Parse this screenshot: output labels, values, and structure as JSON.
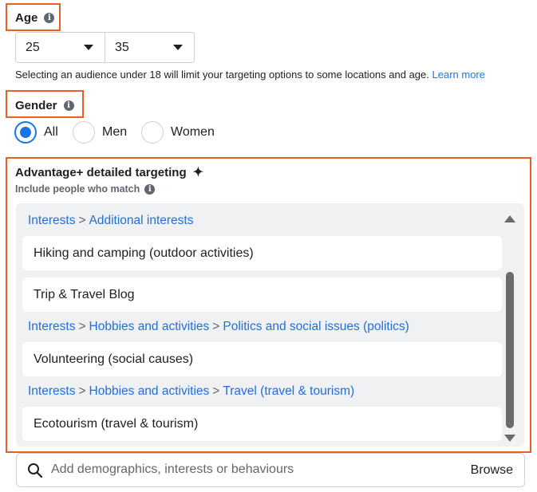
{
  "age": {
    "label": "Age",
    "info_icon": "i",
    "min_value": "25",
    "max_value": "35",
    "note": "Selecting an audience under 18 will limit your targeting options to some locations and age.",
    "learn_more": "Learn more"
  },
  "gender": {
    "label": "Gender",
    "info_icon": "i",
    "options": [
      "All",
      "Men",
      "Women"
    ],
    "selected": "All"
  },
  "detailed_targeting": {
    "title": "Advantage+ detailed targeting",
    "title_icon": "✦",
    "subtitle": "Include people who match",
    "info_icon": "i",
    "groups": [
      {
        "crumbs": [
          "Interests",
          "Additional interests"
        ],
        "items": [
          "Hiking and camping (outdoor activities)",
          "Trip & Travel Blog"
        ]
      },
      {
        "crumbs": [
          "Interests",
          "Hobbies and activities",
          "Politics and social issues (politics)"
        ],
        "items": [
          "Volunteering (social causes)"
        ]
      },
      {
        "crumbs": [
          "Interests",
          "Hobbies and activities",
          "Travel (travel & tourism)"
        ],
        "items": [
          "Ecotourism (travel & tourism)"
        ]
      }
    ],
    "separator": ">"
  },
  "search": {
    "placeholder": "Add demographics, interests or behaviours",
    "browse_label": "Browse"
  },
  "colors": {
    "highlight": "#e8601c",
    "link": "#216fdb",
    "radio_selected": "#1b74e4"
  }
}
